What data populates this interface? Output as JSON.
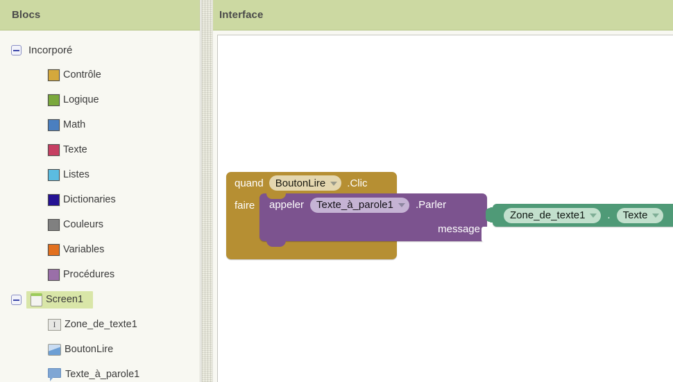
{
  "left_panel": {
    "title": "Blocs",
    "tree": {
      "builtin_group": {
        "label": "Incorporé",
        "toggle": "collapse-toggle",
        "categories": [
          {
            "label": "Contrôle",
            "color": "#d4a83c"
          },
          {
            "label": "Logique",
            "color": "#7aa83c"
          },
          {
            "label": "Math",
            "color": "#4a7fc0"
          },
          {
            "label": "Texte",
            "color": "#c63f62"
          },
          {
            "label": "Listes",
            "color": "#5bbce0"
          },
          {
            "label": "Dictionaries",
            "color": "#251293"
          },
          {
            "label": "Couleurs",
            "color": "#808080"
          },
          {
            "label": "Variables",
            "color": "#e2701e"
          },
          {
            "label": "Procédures",
            "color": "#9a6fa8"
          }
        ]
      },
      "screen_group": {
        "label": "Screen1",
        "selected": true,
        "toggle": "collapse-toggle",
        "components": [
          {
            "label": "Zone_de_texte1",
            "icon": "textbox-icon"
          },
          {
            "label": "BoutonLire",
            "icon": "button-icon"
          },
          {
            "label": "Texte_à_parole1",
            "icon": "text-to-speech-icon"
          }
        ]
      }
    }
  },
  "right_panel": {
    "title": "Interface"
  },
  "blocks": {
    "event_block": {
      "color": "#b68f33",
      "keyword": "quand",
      "component": "BoutonLire",
      "event_suffix": ".Clic",
      "do_label": "faire"
    },
    "call_block": {
      "color": "#7c538f",
      "keyword": "appeler",
      "component": "Texte_à_parole1",
      "method_suffix": ".Parler",
      "arg_label": "message"
    },
    "getter_block": {
      "color": "#4f9a77",
      "component": "Zone_de_texte1",
      "separator": ".",
      "property": "Texte"
    }
  },
  "theme": {
    "header_bg": "#ccd9a2",
    "panel_bg": "#f8f8f2",
    "selection_bg": "#d9e6a8",
    "workspace_bg": "#ffffff"
  }
}
